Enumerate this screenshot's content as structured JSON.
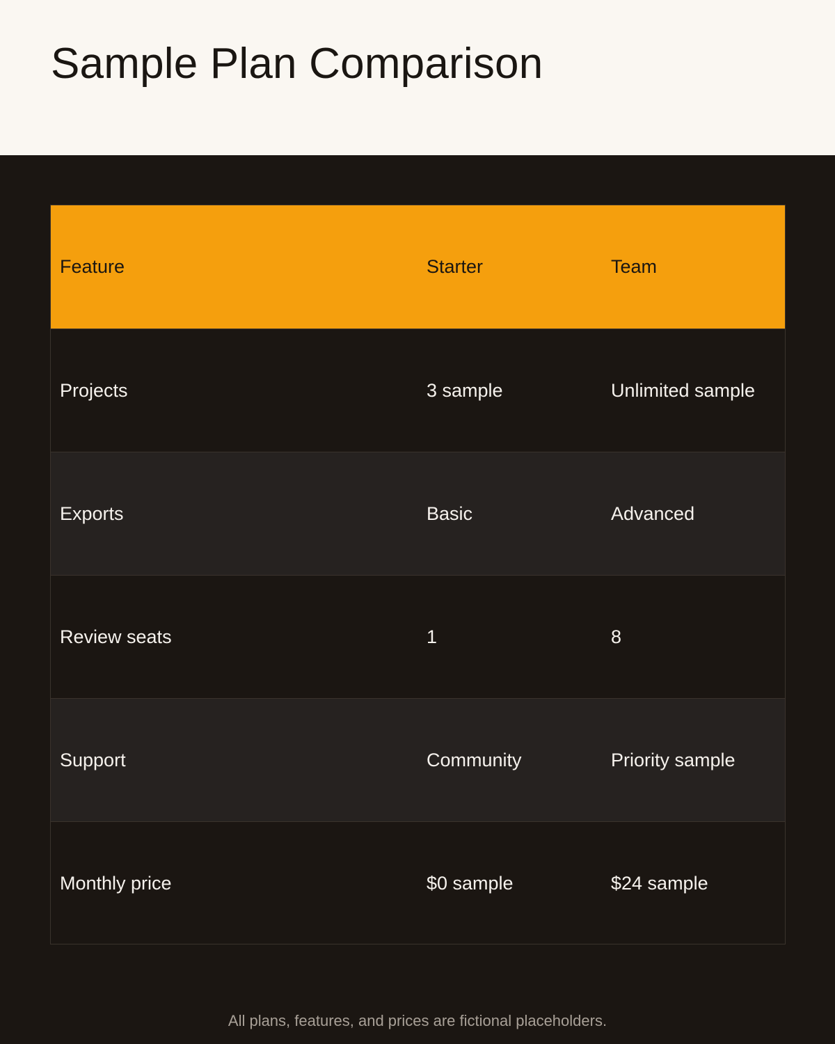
{
  "page": {
    "title": "Sample Plan Comparison",
    "footnote": "All plans, features, and prices are fictional placeholders."
  },
  "table": {
    "headers": [
      "Feature",
      "Starter",
      "Team"
    ],
    "rows": [
      [
        "Projects",
        "3 sample",
        "Unlimited sample"
      ],
      [
        "Exports",
        "Basic",
        "Advanced"
      ],
      [
        "Review seats",
        "1",
        "8"
      ],
      [
        "Support",
        "Community",
        "Priority sample"
      ],
      [
        "Monthly price",
        "$0 sample",
        "$24 sample"
      ]
    ]
  },
  "colors": {
    "header_background": "#faf7f2",
    "page_background": "#1b1612",
    "table_header_accent": "#f59f0d",
    "row_alternate": "#262220",
    "text_light": "#f6f2ed",
    "text_dark": "#1a1612",
    "footnote_text": "#a8a097"
  }
}
